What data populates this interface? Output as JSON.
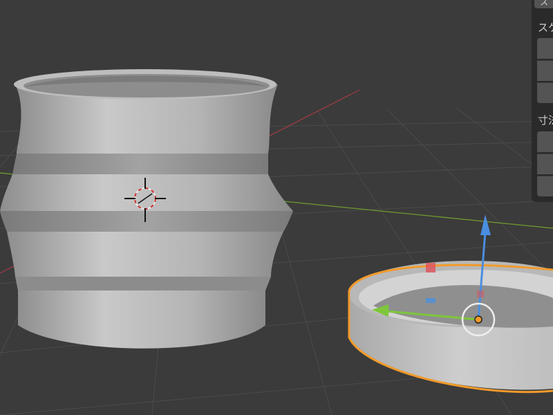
{
  "viewport": {
    "name": "3d-viewport",
    "colors": {
      "background": "#3b3b3b",
      "grid_line": "#4d4d4d",
      "x_axis": "#b0404d",
      "y_axis": "#6e9a2d",
      "selection_outline": "#f29a2a",
      "gizmo_z": "#4a8ee0",
      "gizmo_y": "#7ec63a",
      "gizmo_x": "#e0505a",
      "mesh_light": "#cfcfcf",
      "mesh_mid": "#9a9a9a",
      "mesh_dark": "#6f6f6f"
    },
    "objects": [
      {
        "name": "vase-mesh",
        "selected": false
      },
      {
        "name": "dish-mesh",
        "selected": true
      }
    ],
    "icons": [
      "3d-cursor-icon",
      "move-gizmo-icon",
      "object-origin-icon"
    ]
  },
  "sidebar": {
    "tab_label": "ス",
    "sections": [
      {
        "label": "スケール",
        "fields": [
          "",
          "",
          ""
        ]
      },
      {
        "label": "寸法",
        "fields": [
          "",
          "",
          ""
        ]
      }
    ]
  }
}
